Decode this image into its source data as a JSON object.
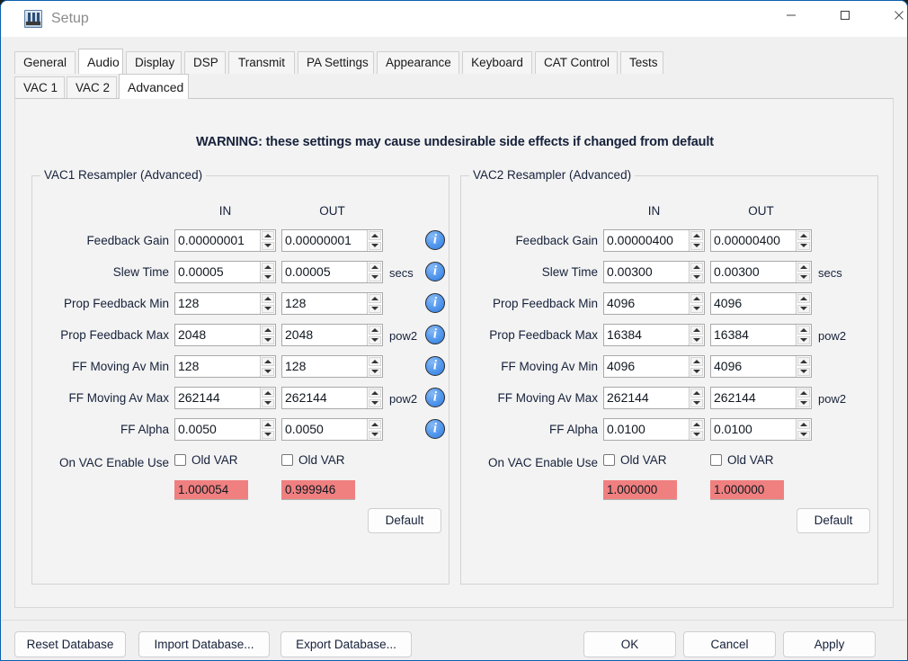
{
  "window": {
    "title": "Setup",
    "icon": "app-icon",
    "controls": {
      "minimize": "minimize-icon",
      "maximize": "maximize-icon",
      "close": "close-icon"
    }
  },
  "tabs_primary": [
    {
      "label": "General",
      "active": false
    },
    {
      "label": "Audio",
      "active": true
    },
    {
      "label": "Display",
      "active": false
    },
    {
      "label": "DSP",
      "active": false
    },
    {
      "label": "Transmit",
      "active": false
    },
    {
      "label": "PA Settings",
      "active": false
    },
    {
      "label": "Appearance",
      "active": false
    },
    {
      "label": "Keyboard",
      "active": false
    },
    {
      "label": "CAT Control",
      "active": false
    },
    {
      "label": "Tests",
      "active": false
    }
  ],
  "tabs_secondary": [
    {
      "label": "VAC 1",
      "active": false
    },
    {
      "label": "VAC 2",
      "active": false
    },
    {
      "label": "Advanced",
      "active": true
    }
  ],
  "warning": "WARNING: these settings may cause undesirable side effects if changed from default",
  "columns": {
    "in": "IN",
    "out": "OUT"
  },
  "groups": [
    {
      "title": "VAC1 Resampler (Advanced)",
      "rows": [
        {
          "label": "Feedback Gain",
          "in": "0.00000001",
          "out": "0.00000001",
          "unit": "",
          "info": true
        },
        {
          "label": "Slew Time",
          "in": "0.00005",
          "out": "0.00005",
          "unit": "secs",
          "info": true
        },
        {
          "label": "Prop Feedback Min",
          "in": "128",
          "out": "128",
          "unit": "",
          "info": true
        },
        {
          "label": "Prop Feedback Max",
          "in": "2048",
          "out": "2048",
          "unit": "pow2",
          "info": true
        },
        {
          "label": "FF Moving Av Min",
          "in": "128",
          "out": "128",
          "unit": "",
          "info": true
        },
        {
          "label": "FF Moving Av Max",
          "in": "262144",
          "out": "262144",
          "unit": "pow2",
          "info": true
        },
        {
          "label": "FF Alpha",
          "in": "0.0050",
          "out": "0.0050",
          "unit": "",
          "info": true
        }
      ],
      "checkbox_row_label": "On VAC Enable Use",
      "checkbox_in_label": "Old VAR",
      "checkbox_out_label": "Old VAR",
      "checkbox_in_checked": false,
      "checkbox_out_checked": false,
      "readout_in": "1.000054",
      "readout_out": "0.999946",
      "default_button": "Default"
    },
    {
      "title": "VAC2 Resampler (Advanced)",
      "rows": [
        {
          "label": "Feedback Gain",
          "in": "0.00000400",
          "out": "0.00000400",
          "unit": "",
          "info": false
        },
        {
          "label": "Slew Time",
          "in": "0.00300",
          "out": "0.00300",
          "unit": "secs",
          "info": false
        },
        {
          "label": "Prop Feedback Min",
          "in": "4096",
          "out": "4096",
          "unit": "",
          "info": false
        },
        {
          "label": "Prop Feedback Max",
          "in": "16384",
          "out": "16384",
          "unit": "pow2",
          "info": false
        },
        {
          "label": "FF Moving Av Min",
          "in": "4096",
          "out": "4096",
          "unit": "",
          "info": false
        },
        {
          "label": "FF Moving Av Max",
          "in": "262144",
          "out": "262144",
          "unit": "pow2",
          "info": false
        },
        {
          "label": "FF Alpha",
          "in": "0.0100",
          "out": "0.0100",
          "unit": "",
          "info": false
        }
      ],
      "checkbox_row_label": "On VAC Enable Use",
      "checkbox_in_label": "Old VAR",
      "checkbox_out_label": "Old VAR",
      "checkbox_in_checked": false,
      "checkbox_out_checked": false,
      "readout_in": "1.000000",
      "readout_out": "1.000000",
      "default_button": "Default"
    }
  ],
  "footer": {
    "reset_database": "Reset Database",
    "import_database": "Import Database...",
    "export_database": "Export Database...",
    "ok": "OK",
    "cancel": "Cancel",
    "apply": "Apply"
  },
  "colors": {
    "readout_background": "#f08080",
    "info_icon": "#2f7de0",
    "window_border": "#0a60b0",
    "panel_background": "#f3f3f3"
  }
}
